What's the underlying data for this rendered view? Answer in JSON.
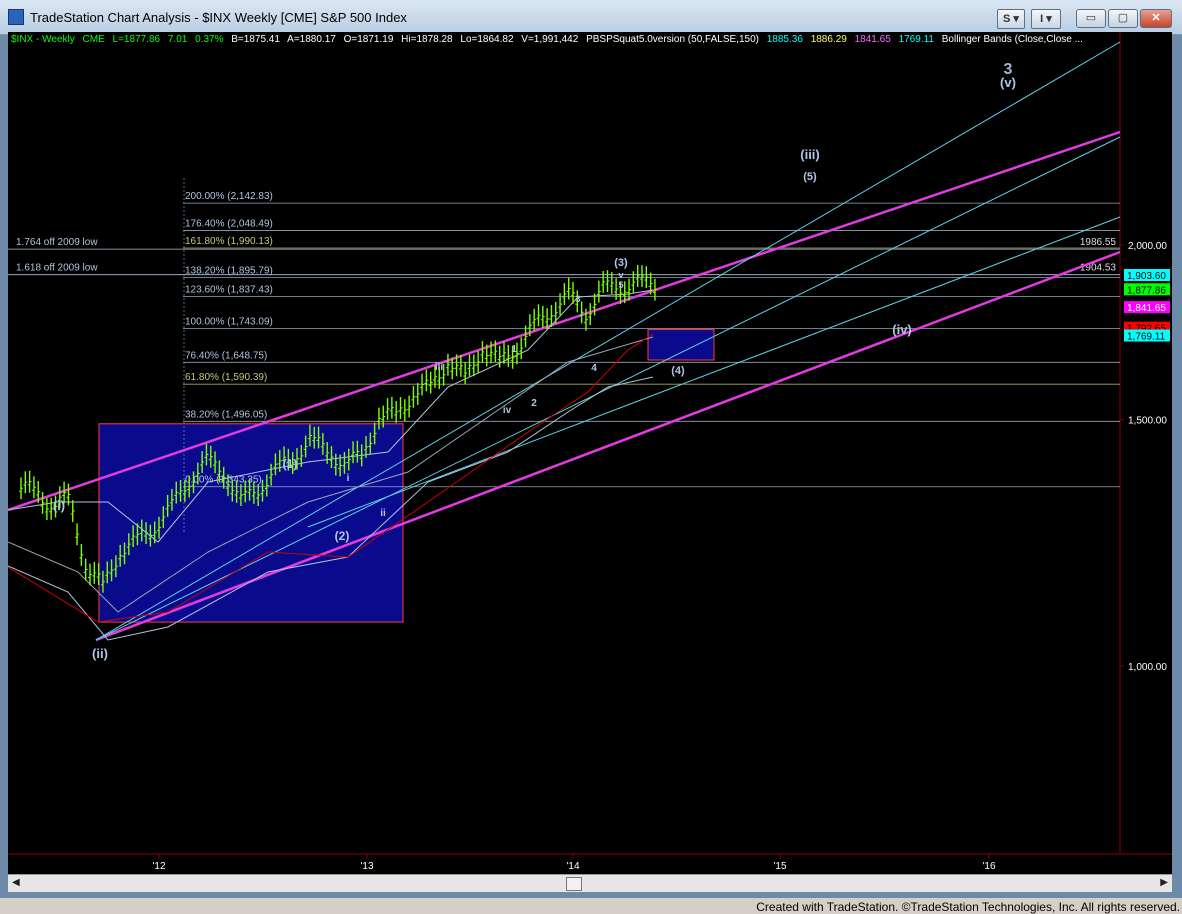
{
  "window": {
    "title": "TradeStation Chart Analysis - $INX Weekly [CME] S&P 500 Index",
    "btn_s": "S",
    "btn_i": "I",
    "min_glyph": "▭",
    "max_glyph": "▢",
    "close_glyph": "✕"
  },
  "infobar": {
    "symbol": "$INX - Weekly",
    "exchange": "CME",
    "last": "L=1877.86",
    "change": "7.01",
    "pct": "0.37%",
    "bid": "B=1875.41",
    "ask": "A=1880.17",
    "open": "O=1871.19",
    "high": "Hi=1878.28",
    "low": "Lo=1864.82",
    "volume": "V=1,991,442",
    "indicator": "PBSPSquat5.0version (50,FALSE,150)",
    "ind_v1": "1885.36",
    "ind_v2": "1886.29",
    "ind_v3": "1841.65",
    "ind_v4": "1769.11",
    "ind_name2": "Bollinger Bands (Close,Close ..."
  },
  "footer": "Created with TradeStation. ©TradeStation Technologies, Inc. All rights reserved.",
  "chart_data": {
    "type": "line",
    "scale": "log",
    "title": "$INX Weekly [CME] S&P 500 Index",
    "ylim": [
      700,
      3100
    ],
    "x_ticks": [
      "'12",
      "'13",
      "'14",
      "'15",
      "'16"
    ],
    "y_ticks": [
      {
        "value": 1000,
        "label": "1,000.00"
      },
      {
        "value": 1500,
        "label": "1,500.00"
      },
      {
        "value": 2000,
        "label": "2,000.00"
      }
    ],
    "price_tags": [
      {
        "value": 1903.6,
        "label": "1,903.60",
        "color": "#00ffff",
        "text_color": "#000"
      },
      {
        "value": 1877.86,
        "label": "1,877.86",
        "color": "#00ff00",
        "text_color": "#000"
      },
      {
        "value": 1841.65,
        "label": "1,841.65",
        "color": "#ff00ff",
        "text_color": "#fff"
      },
      {
        "value": 1792.0,
        "label": "1,792.65",
        "color": "#ff0000",
        "text_color": "#000"
      },
      {
        "value": 1769.11,
        "label": "1,769.11",
        "color": "#00ffff",
        "text_color": "#000"
      }
    ],
    "fib_levels": [
      {
        "label": "200.00% (2,142.83)",
        "value": 2142.83,
        "color": "#b0c4de"
      },
      {
        "label": "176.40% (2,048.49)",
        "value": 2048.49,
        "color": "#b0c4de"
      },
      {
        "label": "161.80% (1,990.13)",
        "value": 1990.13,
        "color": "#c8c87a"
      },
      {
        "label": "138.20% (1,895.79)",
        "value": 1895.79,
        "color": "#b0c4de"
      },
      {
        "label": "123.60% (1,837.43)",
        "value": 1837.43,
        "color": "#b0c4de"
      },
      {
        "label": "100.00% (1,743.09)",
        "value": 1743.09,
        "color": "#b0c4de"
      },
      {
        "label": "76.40% (1,648.75)",
        "value": 1648.75,
        "color": "#b0c4de"
      },
      {
        "label": "61.80% (1,590.39)",
        "value": 1590.39,
        "color": "#c8c87a"
      },
      {
        "label": "38.20% (1,496.05)",
        "value": 1496.05,
        "color": "#b0c4de"
      },
      {
        "label": "0.00% (1,343.35)",
        "value": 1343.35,
        "color": "#b0c4de"
      }
    ],
    "ref_lines": [
      {
        "label": "1.764 off 2009 low",
        "value": 1986.55,
        "right_label": "1986.55"
      },
      {
        "label": "1.618 off 2009 low",
        "value": 1904.53,
        "right_label": "1904.53"
      }
    ],
    "wave_labels": [
      {
        "text": "3",
        "big": true
      },
      {
        "text": "(v)"
      },
      {
        "text": "(iii)"
      },
      {
        "text": "(5)"
      },
      {
        "text": "(iv)"
      },
      {
        "text": "(3)"
      },
      {
        "text": "v"
      },
      {
        "text": "5"
      },
      {
        "text": "(4)"
      },
      {
        "text": "3"
      },
      {
        "text": "1"
      },
      {
        "text": "iii"
      },
      {
        "text": "4"
      },
      {
        "text": "2"
      },
      {
        "text": "iv"
      },
      {
        "text": "(1)"
      },
      {
        "text": "i"
      },
      {
        "text": "ii"
      },
      {
        "text": "(2)"
      },
      {
        "text": "(i)"
      },
      {
        "text": "(ii)"
      }
    ],
    "series": [
      {
        "type": "ohlc-weekly",
        "color": "#7fff00",
        "points": [
          [
            "2011-05",
            1340
          ],
          [
            "2011-06",
            1300
          ],
          [
            "2011-07",
            1320
          ],
          [
            "2011-08",
            1180
          ],
          [
            "2011-09",
            1140
          ],
          [
            "2011-10",
            1210
          ],
          [
            "2011-11",
            1230
          ],
          [
            "2011-12",
            1260
          ],
          [
            "2012-01",
            1300
          ],
          [
            "2012-02",
            1360
          ],
          [
            "2012-03",
            1400
          ],
          [
            "2012-04",
            1380
          ],
          [
            "2012-05",
            1310
          ],
          [
            "2012-06",
            1340
          ],
          [
            "2012-07",
            1380
          ],
          [
            "2012-08",
            1410
          ],
          [
            "2012-09",
            1450
          ],
          [
            "2012-10",
            1430
          ],
          [
            "2012-11",
            1390
          ],
          [
            "2012-12",
            1420
          ],
          [
            "2013-01",
            1500
          ],
          [
            "2013-02",
            1520
          ],
          [
            "2013-03",
            1560
          ],
          [
            "2013-04",
            1590
          ],
          [
            "2013-05",
            1650
          ],
          [
            "2013-06",
            1610
          ],
          [
            "2013-07",
            1690
          ],
          [
            "2013-08",
            1650
          ],
          [
            "2013-09",
            1690
          ],
          [
            "2013-10",
            1750
          ],
          [
            "2013-11",
            1800
          ],
          [
            "2013-12",
            1840
          ],
          [
            "2014-01",
            1790
          ],
          [
            "2014-02",
            1860
          ],
          [
            "2014-03",
            1870
          ],
          [
            "2014-04",
            1880
          ],
          [
            "2014-05",
            1878
          ]
        ]
      }
    ],
    "target_boxes": [
      {
        "name": "box-2",
        "y_range": [
          1075,
          1490
        ]
      },
      {
        "name": "box-4",
        "y_range": [
          1655,
          1740
        ]
      }
    ]
  }
}
